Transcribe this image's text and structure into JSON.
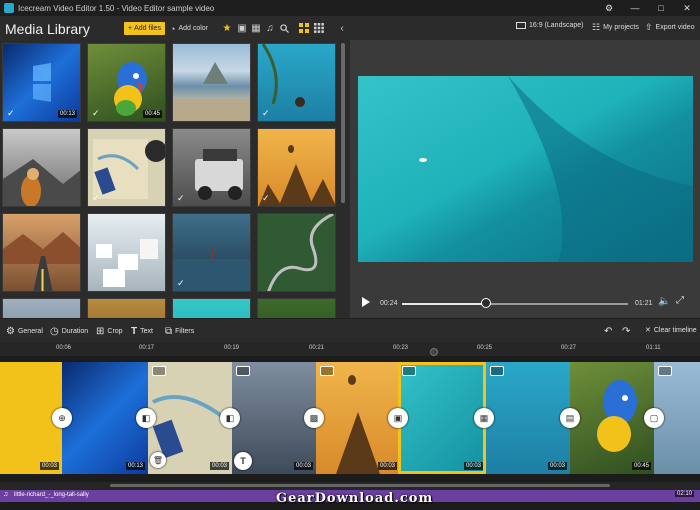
{
  "window": {
    "title": "Icecream Video Editor 1.50 - Video Editor sample video",
    "controls": [
      "⚙",
      "—",
      "□",
      "✕"
    ]
  },
  "library": {
    "title": "Media Library",
    "add_files_label": "Add files",
    "add_color_label": "Add color",
    "thumbs": [
      {
        "duration": "00:13",
        "checked": true
      },
      {
        "duration": "00:45",
        "checked": true
      },
      {
        "duration": "",
        "checked": false
      },
      {
        "duration": "",
        "checked": true
      },
      {
        "duration": "",
        "checked": false
      },
      {
        "duration": "",
        "checked": true
      },
      {
        "duration": "",
        "checked": true
      },
      {
        "duration": "",
        "checked": true
      },
      {
        "duration": "",
        "checked": false
      },
      {
        "duration": "",
        "checked": false
      },
      {
        "duration": "",
        "checked": true
      },
      {
        "duration": "",
        "checked": false
      }
    ]
  },
  "player": {
    "aspect_label": "16:9 (Landscape)",
    "my_projects_label": "My projects",
    "export_label": "Export video",
    "current_time": "00:24",
    "total_time": "01:21",
    "progress": 0.37
  },
  "toolbar": {
    "general": "General",
    "duration": "Duration",
    "crop": "Crop",
    "text": "Text",
    "filters": "Filters",
    "clear_timeline": "Clear timeline"
  },
  "ruler": {
    "ticks": [
      "00:06",
      "00:17",
      "00:19",
      "00:21",
      "00:23",
      "00:25",
      "00:27",
      "01:11"
    ]
  },
  "timeline": {
    "clips": [
      {
        "duration": "00:03"
      },
      {
        "duration": "00:13"
      },
      {
        "duration": "00:03"
      },
      {
        "duration": "00:03"
      },
      {
        "duration": "00:03"
      },
      {
        "duration": "00:03"
      },
      {
        "duration": "00:03"
      },
      {
        "duration": "00:45"
      },
      {
        "duration": ""
      }
    ]
  },
  "audio": {
    "track_name": "little-richard_-_long-tall-sally",
    "duration": "02:10"
  },
  "watermark": "GearDownload.com",
  "colors": {
    "accent": "#f3c21b",
    "audio_track": "#6a3fa0",
    "background": "#2b2b2b"
  }
}
